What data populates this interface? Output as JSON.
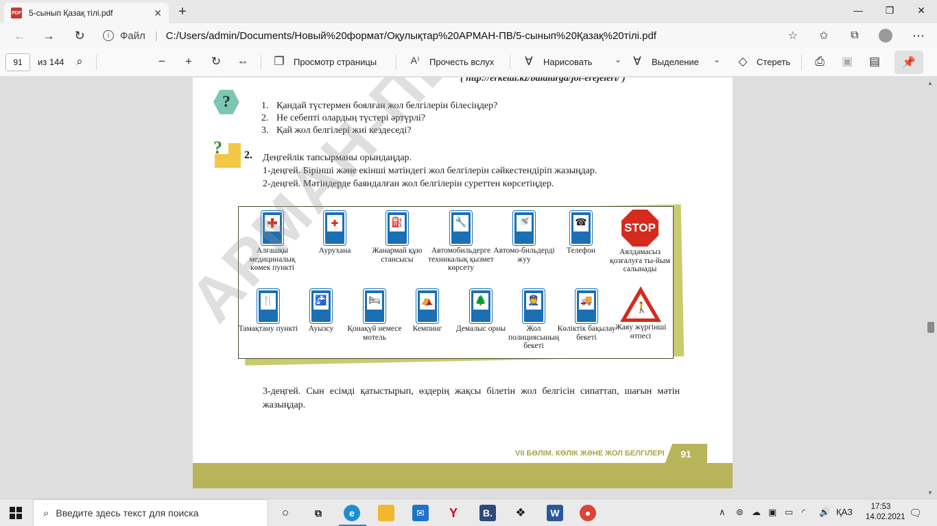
{
  "browser": {
    "tab_title": "5-сынып Қазақ тілі.pdf",
    "tab_close": "✕",
    "new_tab": "+",
    "url_scheme": "Файл",
    "url": "C:/Users/admin/Documents/Новый%20формат/Оқулықтар%20АРМАН-ПВ/5-сынып%20Қазақ%20тілі.pdf"
  },
  "pdf_toolbar": {
    "page_number": "91",
    "page_total": "из 144",
    "page_view": "Просмотр страницы",
    "read_aloud": "Прочесть вслух",
    "draw": "Нарисовать",
    "highlight": "Выделение",
    "erase": "Стереть"
  },
  "document": {
    "source_link": "( http://erketai.kz/balalarga/jol-erejeleri/ )",
    "questions": [
      {
        "num": "1.",
        "text": "Қандай түстермен боялған жол белгілерін білесіңдер?"
      },
      {
        "num": "2.",
        "text": "Не себепті олардың түстері әртүрлі?"
      },
      {
        "num": "3.",
        "text": "Қай жол белгілері жиі кездеседі?"
      }
    ],
    "task_number": "2.",
    "task_lines": [
      "Деңгейлік тапсырманы орындаңдар.",
      "1-деңгей. Бірінші және екінші мәтіндегі жол белгілерін сәйкестендіріп жазыңдар.",
      "2-деңгей. Мәтіндерде баяндалған жол белгілерін суреттен көрсетіңдер."
    ],
    "signs_row1": [
      {
        "label": "Алғашқы медициналық көмек пункті",
        "glyph": "✚"
      },
      {
        "label": "Аурухана",
        "glyph": "✚"
      },
      {
        "label": "Жанармай құю стансысы",
        "glyph": "⛽"
      },
      {
        "label": "Автомобильдерге техникалық қызмет көрсету",
        "glyph": "🔧"
      },
      {
        "label": "Автомо-бильдерді жуу",
        "glyph": "🚿"
      },
      {
        "label": "Телефон",
        "glyph": "☎"
      },
      {
        "label": "Аялдамасыз қозғалуға ты-йым салынады",
        "glyph": "STOP"
      }
    ],
    "signs_row2": [
      {
        "label": "Тамақтану пункті",
        "glyph": "🍴"
      },
      {
        "label": "Ауызсу",
        "glyph": "🚰"
      },
      {
        "label": "Қонақүй немесе мотель",
        "glyph": "🛏"
      },
      {
        "label": "Кемпинг",
        "glyph": "⛺"
      },
      {
        "label": "Демалыс орны",
        "glyph": "🌲"
      },
      {
        "label": "Жол полициясының бекеті",
        "glyph": "👮"
      },
      {
        "label": "Көліктік бақылау бекеті",
        "glyph": "🚚"
      },
      {
        "label": "Жаяу жүргінші өтпесі",
        "glyph": "🚶"
      }
    ],
    "level3": "3-деңгей. Сын есімді қатыстырып, өздерің жақсы білетін жол белгісін сипаттап, шағын мәтін жазыңдар.",
    "footer_section": "VII БӨЛІМ. КӨЛІК ЖӘНЕ ЖОЛ БЕЛГІЛЕРІ",
    "footer_page": "91",
    "watermark": "АРМАН-ПВ"
  },
  "taskbar": {
    "search_placeholder": "Введите здесь текст для поиска",
    "lang": "ҚАЗ",
    "time": "17:53",
    "date": "14.02.2021"
  }
}
